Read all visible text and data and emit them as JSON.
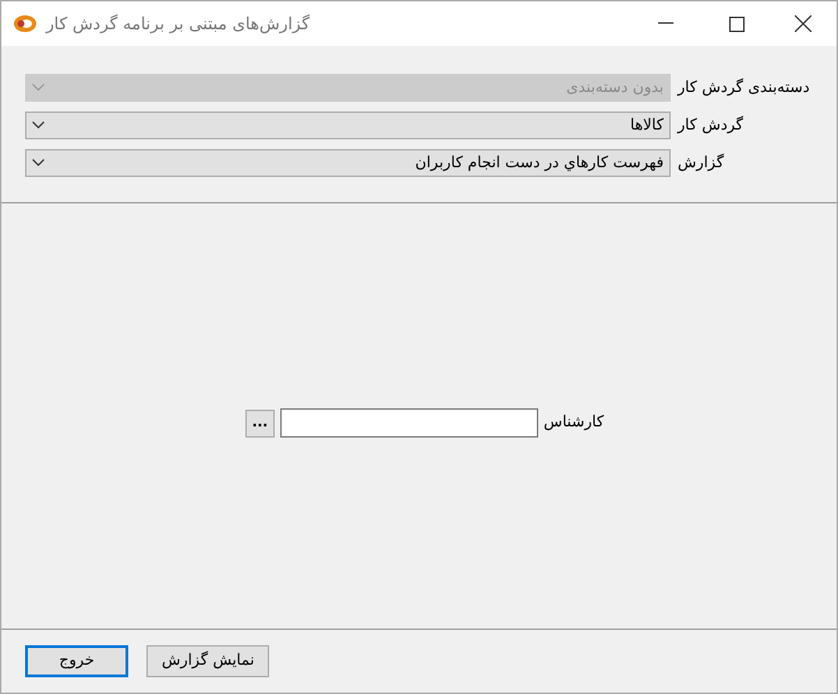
{
  "window": {
    "title": "گزارش‌های مبتنی بر برنامه گردش کار"
  },
  "selectors": [
    {
      "label": "دسته‌بندی گردش کار",
      "value": "بدون دسته‌بندی",
      "disabled": true
    },
    {
      "label": "گردش کار",
      "value": "کالاها",
      "disabled": false
    },
    {
      "label": "گزارش",
      "value": "فهرست کارهاي در دست انجام کاربران",
      "disabled": false
    }
  ],
  "parameter": {
    "label": "کارشناس",
    "browse": "..."
  },
  "buttons": [
    {
      "label": "نمایش گزارش",
      "selected": false
    },
    {
      "label": "خروج",
      "selected": true
    }
  ]
}
